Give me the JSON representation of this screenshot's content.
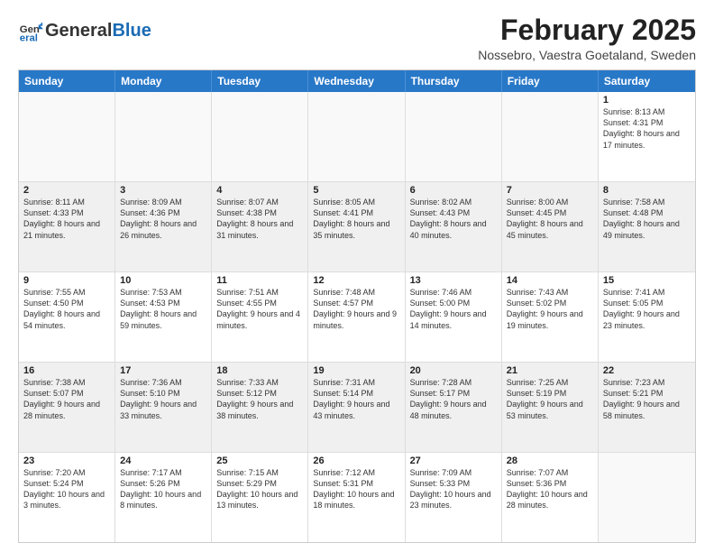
{
  "header": {
    "logo_general": "General",
    "logo_blue": "Blue",
    "month_title": "February 2025",
    "location": "Nossebro, Vaestra Goetaland, Sweden"
  },
  "days_of_week": [
    "Sunday",
    "Monday",
    "Tuesday",
    "Wednesday",
    "Thursday",
    "Friday",
    "Saturday"
  ],
  "weeks": [
    [
      {
        "day": "",
        "empty": true
      },
      {
        "day": "",
        "empty": true
      },
      {
        "day": "",
        "empty": true
      },
      {
        "day": "",
        "empty": true
      },
      {
        "day": "",
        "empty": true
      },
      {
        "day": "",
        "empty": true
      },
      {
        "day": "1",
        "sunrise": "8:13 AM",
        "sunset": "4:31 PM",
        "daylight": "8 hours and 17 minutes."
      }
    ],
    [
      {
        "day": "2",
        "sunrise": "8:11 AM",
        "sunset": "4:33 PM",
        "daylight": "8 hours and 21 minutes."
      },
      {
        "day": "3",
        "sunrise": "8:09 AM",
        "sunset": "4:36 PM",
        "daylight": "8 hours and 26 minutes."
      },
      {
        "day": "4",
        "sunrise": "8:07 AM",
        "sunset": "4:38 PM",
        "daylight": "8 hours and 31 minutes."
      },
      {
        "day": "5",
        "sunrise": "8:05 AM",
        "sunset": "4:41 PM",
        "daylight": "8 hours and 35 minutes."
      },
      {
        "day": "6",
        "sunrise": "8:02 AM",
        "sunset": "4:43 PM",
        "daylight": "8 hours and 40 minutes."
      },
      {
        "day": "7",
        "sunrise": "8:00 AM",
        "sunset": "4:45 PM",
        "daylight": "8 hours and 45 minutes."
      },
      {
        "day": "8",
        "sunrise": "7:58 AM",
        "sunset": "4:48 PM",
        "daylight": "8 hours and 49 minutes."
      }
    ],
    [
      {
        "day": "9",
        "sunrise": "7:55 AM",
        "sunset": "4:50 PM",
        "daylight": "8 hours and 54 minutes."
      },
      {
        "day": "10",
        "sunrise": "7:53 AM",
        "sunset": "4:53 PM",
        "daylight": "8 hours and 59 minutes."
      },
      {
        "day": "11",
        "sunrise": "7:51 AM",
        "sunset": "4:55 PM",
        "daylight": "9 hours and 4 minutes."
      },
      {
        "day": "12",
        "sunrise": "7:48 AM",
        "sunset": "4:57 PM",
        "daylight": "9 hours and 9 minutes."
      },
      {
        "day": "13",
        "sunrise": "7:46 AM",
        "sunset": "5:00 PM",
        "daylight": "9 hours and 14 minutes."
      },
      {
        "day": "14",
        "sunrise": "7:43 AM",
        "sunset": "5:02 PM",
        "daylight": "9 hours and 19 minutes."
      },
      {
        "day": "15",
        "sunrise": "7:41 AM",
        "sunset": "5:05 PM",
        "daylight": "9 hours and 23 minutes."
      }
    ],
    [
      {
        "day": "16",
        "sunrise": "7:38 AM",
        "sunset": "5:07 PM",
        "daylight": "9 hours and 28 minutes."
      },
      {
        "day": "17",
        "sunrise": "7:36 AM",
        "sunset": "5:10 PM",
        "daylight": "9 hours and 33 minutes."
      },
      {
        "day": "18",
        "sunrise": "7:33 AM",
        "sunset": "5:12 PM",
        "daylight": "9 hours and 38 minutes."
      },
      {
        "day": "19",
        "sunrise": "7:31 AM",
        "sunset": "5:14 PM",
        "daylight": "9 hours and 43 minutes."
      },
      {
        "day": "20",
        "sunrise": "7:28 AM",
        "sunset": "5:17 PM",
        "daylight": "9 hours and 48 minutes."
      },
      {
        "day": "21",
        "sunrise": "7:25 AM",
        "sunset": "5:19 PM",
        "daylight": "9 hours and 53 minutes."
      },
      {
        "day": "22",
        "sunrise": "7:23 AM",
        "sunset": "5:21 PM",
        "daylight": "9 hours and 58 minutes."
      }
    ],
    [
      {
        "day": "23",
        "sunrise": "7:20 AM",
        "sunset": "5:24 PM",
        "daylight": "10 hours and 3 minutes."
      },
      {
        "day": "24",
        "sunrise": "7:17 AM",
        "sunset": "5:26 PM",
        "daylight": "10 hours and 8 minutes."
      },
      {
        "day": "25",
        "sunrise": "7:15 AM",
        "sunset": "5:29 PM",
        "daylight": "10 hours and 13 minutes."
      },
      {
        "day": "26",
        "sunrise": "7:12 AM",
        "sunset": "5:31 PM",
        "daylight": "10 hours and 18 minutes."
      },
      {
        "day": "27",
        "sunrise": "7:09 AM",
        "sunset": "5:33 PM",
        "daylight": "10 hours and 23 minutes."
      },
      {
        "day": "28",
        "sunrise": "7:07 AM",
        "sunset": "5:36 PM",
        "daylight": "10 hours and 28 minutes."
      },
      {
        "day": "",
        "empty": true
      }
    ]
  ]
}
